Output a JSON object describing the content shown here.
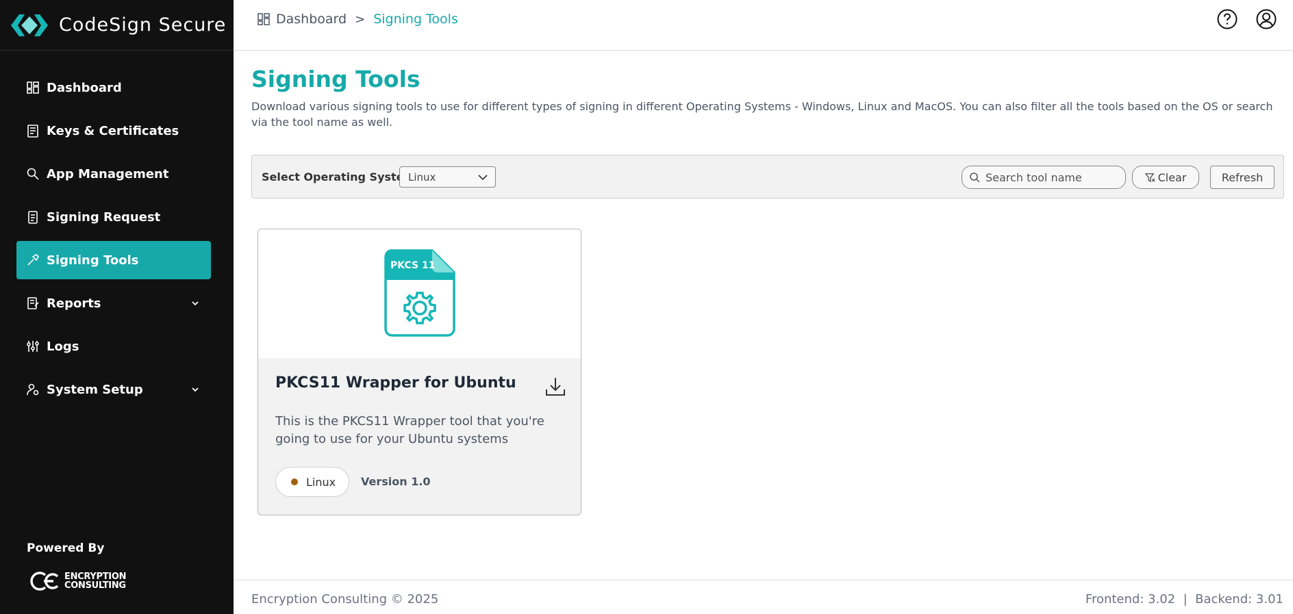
{
  "brand": {
    "name": "CodeSign Secure"
  },
  "sidebar": {
    "items": [
      {
        "label": "Dashboard",
        "icon": "dashboard-icon",
        "active": false
      },
      {
        "label": "Keys & Certificates",
        "icon": "certificate-icon",
        "active": false
      },
      {
        "label": "App Management",
        "icon": "app-search-icon",
        "active": false
      },
      {
        "label": "Signing Request",
        "icon": "request-icon",
        "active": false
      },
      {
        "label": "Signing Tools",
        "icon": "tool-icon",
        "active": true
      },
      {
        "label": "Reports",
        "icon": "report-icon",
        "active": false,
        "expandable": true
      },
      {
        "label": "Logs",
        "icon": "sliders-icon",
        "active": false
      },
      {
        "label": "System Setup",
        "icon": "user-gear-icon",
        "active": false,
        "expandable": true
      }
    ],
    "powered_by": "Powered By",
    "partner_logo_text": [
      "ENCRYPTION",
      "CONSULTING"
    ]
  },
  "header": {
    "breadcrumb": {
      "home": "Dashboard",
      "separator": ">",
      "current": "Signing Tools"
    },
    "help_icon": "question-circle-icon",
    "profile_icon": "user-circle-icon"
  },
  "main": {
    "title": "Signing Tools",
    "description": "Download various signing tools to use for different types of signing in different Operating Systems - Windows, Linux and MacOS. You can also filter all the tools based on the OS or search via the tool name as well.",
    "filter": {
      "os_label": "Select Operating System:",
      "os_selected": "Linux",
      "search_placeholder": "Search tool name",
      "clear_label": "Clear",
      "refresh_label": "Refresh"
    },
    "tools": [
      {
        "icon_label": "PKCS 11",
        "title": "PKCS11 Wrapper for Ubuntu",
        "description": "This is the PKCS11 Wrapper tool that you're going to use for your Ubuntu systems",
        "os": "Linux",
        "version": "Version 1.0"
      }
    ]
  },
  "footer": {
    "copyright": "Encryption Consulting © 2025",
    "versions": "Frontend: 3.02  |  Backend: 3.01"
  },
  "colors": {
    "accent": "#17a9a9",
    "sidebar_bg": "#111111",
    "os_dot": "#a0620f"
  }
}
